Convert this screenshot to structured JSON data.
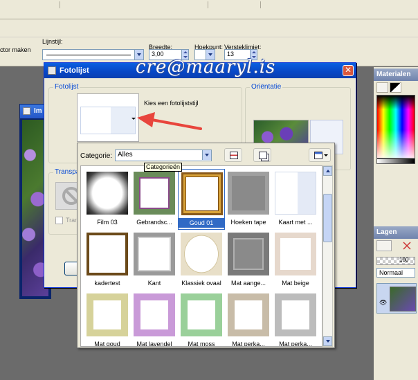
{
  "toolbar": {
    "left_label": "ctor maken",
    "line_style_label": "Lijnstijl:",
    "width_label": "Breedte:",
    "width_value": "3,00",
    "corner_label": "Hoekpunt:",
    "miter_label": "Versteklimiet:",
    "miter_value": "13"
  },
  "background_window": {
    "title": "Im"
  },
  "watermark": "cre@maaryl.is",
  "dialog": {
    "title": "Fotolijst",
    "group_frame": "Fotolijst",
    "choose_label": "Kies een fotolijststijl",
    "group_orientation": "Oriëntatie",
    "group_transparency": "Transpa",
    "transparency_checkbox": "Tran"
  },
  "popup": {
    "category_label": "Categorie:",
    "category_value": "Alles",
    "tooltip": "Categorieën",
    "items": [
      {
        "name": "Film 03",
        "style": "film"
      },
      {
        "name": "Gebrandsc...",
        "style": "stained"
      },
      {
        "name": "Goud 01",
        "style": "gold",
        "selected": true
      },
      {
        "name": "Hoeken tape",
        "style": "tape"
      },
      {
        "name": "Kaart met ...",
        "style": "card"
      },
      {
        "name": "kadertest",
        "style": "kadertest"
      },
      {
        "name": "Kant",
        "style": "lace"
      },
      {
        "name": "Klassiek ovaal",
        "style": "oval"
      },
      {
        "name": "Mat aange...",
        "style": "matdark"
      },
      {
        "name": "Mat beige",
        "style": "matbeige"
      },
      {
        "name": "Mat goud",
        "style": "matgoud"
      },
      {
        "name": "Mat lavendel",
        "style": "matlav"
      },
      {
        "name": "Mat moss",
        "style": "matmoss"
      },
      {
        "name": "Mat perka...",
        "style": "matperk"
      },
      {
        "name": "Mat perka...",
        "style": "matperk2"
      }
    ]
  },
  "panels": {
    "materials_title": "Materialen",
    "layers_title": "Lagen",
    "opacity_value": "100",
    "blend_mode": "Normaal"
  },
  "colors": {
    "title_bar": "#0a5fe0",
    "selection": "#316ac5",
    "arrow": "#e8453c"
  }
}
